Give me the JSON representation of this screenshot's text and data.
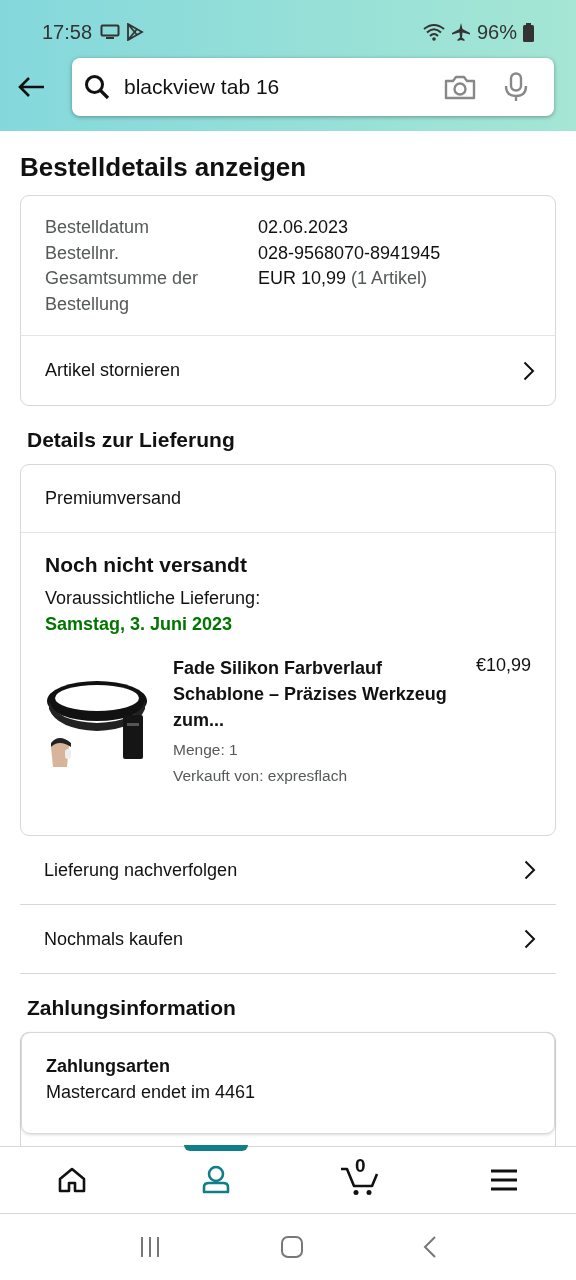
{
  "status_bar": {
    "time": "17:58",
    "battery": "96%"
  },
  "search": {
    "value": "blackview tab 16"
  },
  "title": "Bestelldetails anzeigen",
  "order": {
    "fields": [
      {
        "label": "Bestelldatum",
        "value": "02.06.2023"
      },
      {
        "label": "Bestellnr.",
        "value": "028-9568070-8941945"
      },
      {
        "label": "Gesamtsumme der Bestellung",
        "value": "EUR 10,99",
        "note": "(1 Artikel)"
      }
    ],
    "action": "Artikel stornieren"
  },
  "delivery": {
    "heading": "Details zur Lieferung",
    "method": "Premiumversand",
    "status": "Noch nicht versandt",
    "eta_label": "Voraussichtliche Lieferung:",
    "eta": "Samstag, 3. Juni 2023",
    "item": {
      "kind": "picture",
      "title": "Fade Silikon Farbverlauf Schablone – Präzises Werkzeug zum...",
      "price": "€10,99",
      "quantity": "Menge: 1",
      "seller": "Verkauft von: expresflach"
    }
  },
  "links": [
    "Lieferung nachverfolgen",
    "Nochmals kaufen"
  ],
  "payment": {
    "heading": "Zahlungsinformation",
    "method_label": "Zahlungsarten",
    "method": "Mastercard  endet im 4461"
  },
  "bottom_nav": [
    {
      "kind": "home",
      "selected": false
    },
    {
      "kind": "account",
      "selected": true
    },
    {
      "kind": "cart",
      "selected": false,
      "count": "0"
    },
    {
      "kind": "menu",
      "selected": false
    }
  ]
}
